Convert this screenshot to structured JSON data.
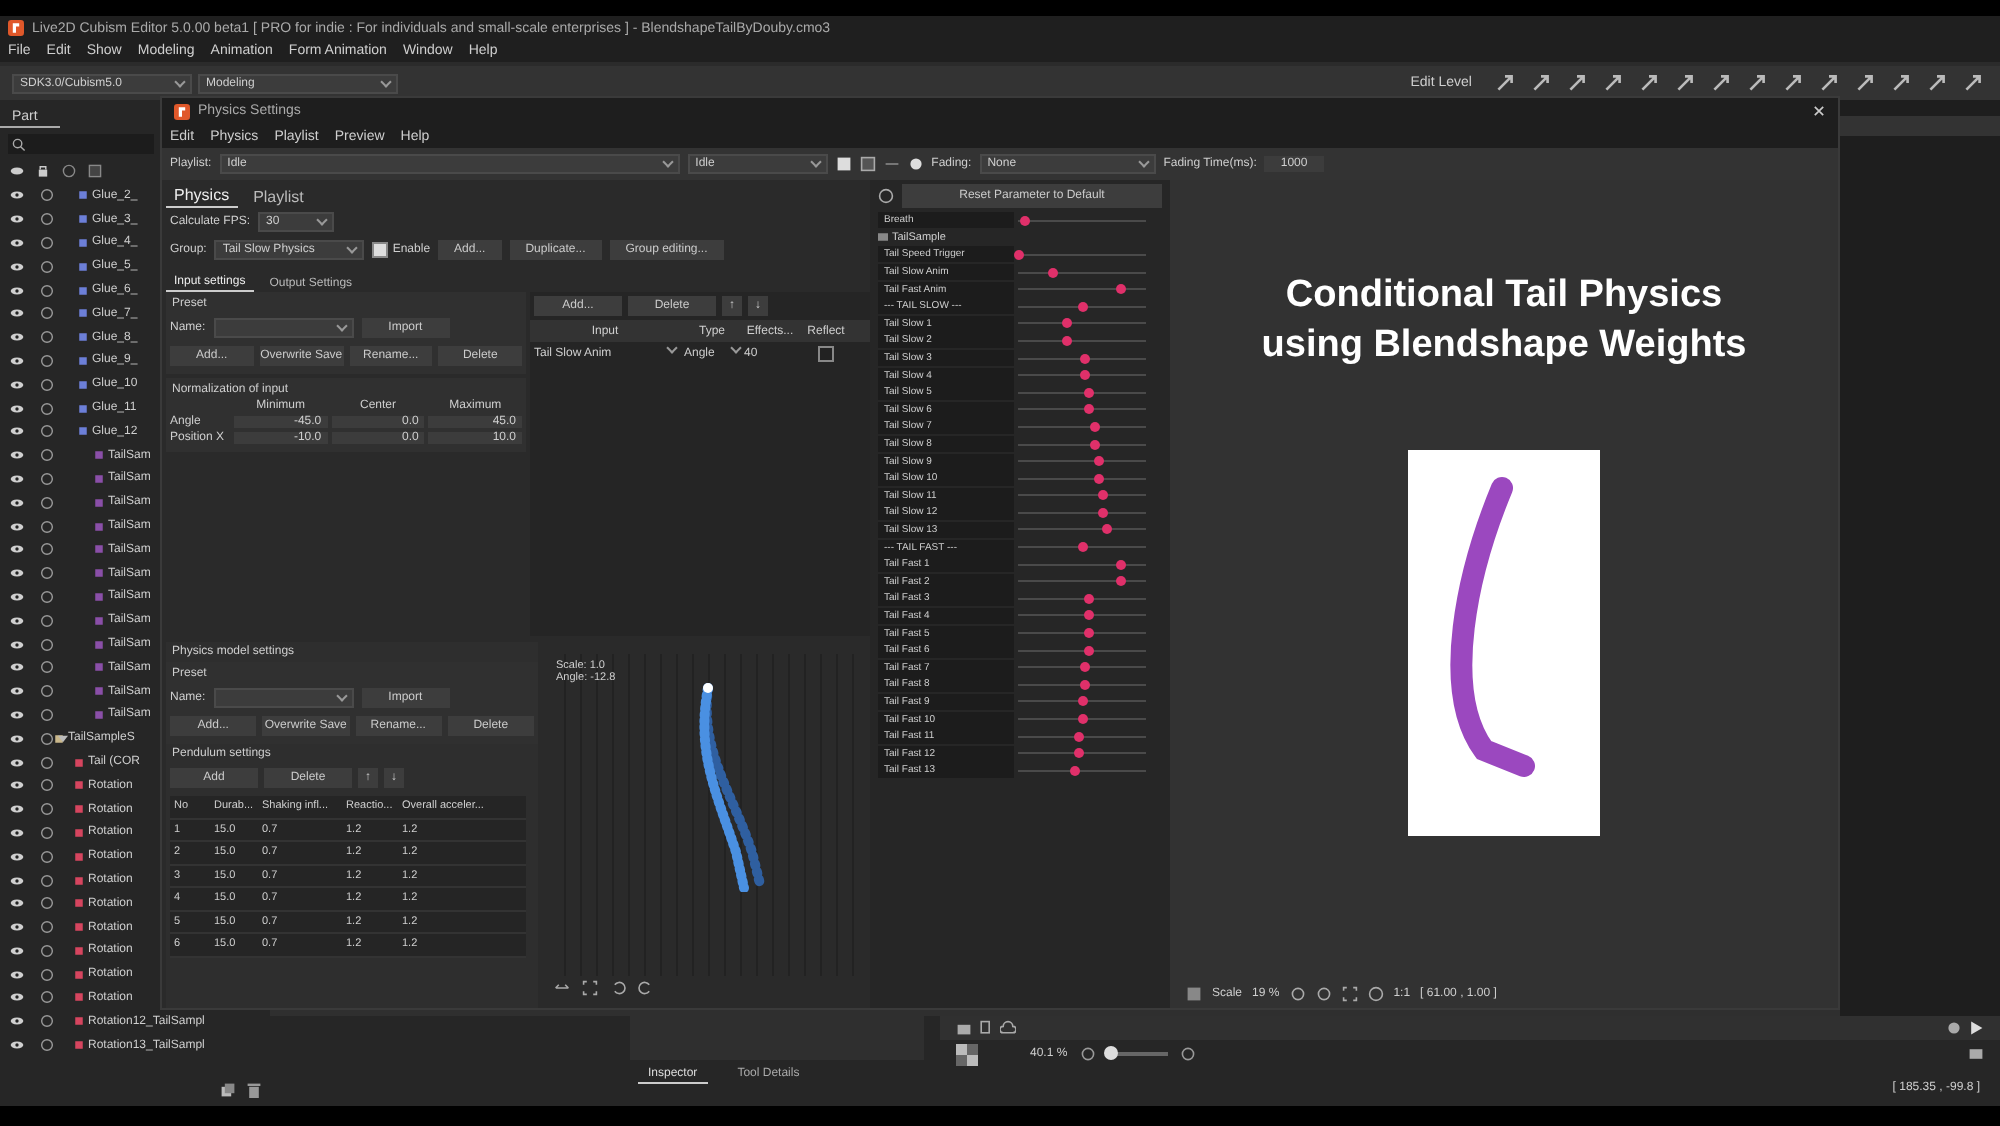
{
  "app": {
    "title": "Live2D Cubism Editor 5.0.00 beta1  [ PRO for indie : For individuals and small-scale enterprises ]  -  BlendshapeTailByDouby.cmo3",
    "menu": [
      "File",
      "Edit",
      "Show",
      "Modeling",
      "Animation",
      "Form Animation",
      "Window",
      "Help"
    ],
    "toolbar": {
      "version": "SDK3.0/Cubism5.0",
      "mode": "Modeling",
      "edit_level": "Edit Level"
    }
  },
  "parts_panel": {
    "tab": "Part",
    "tree": [
      {
        "label": "Glue_2_",
        "kind": "glue"
      },
      {
        "label": "Glue_3_",
        "kind": "glue"
      },
      {
        "label": "Glue_4_",
        "kind": "glue"
      },
      {
        "label": "Glue_5_",
        "kind": "glue"
      },
      {
        "label": "Glue_6_",
        "kind": "glue"
      },
      {
        "label": "Glue_7_",
        "kind": "glue"
      },
      {
        "label": "Glue_8_",
        "kind": "glue"
      },
      {
        "label": "Glue_9_",
        "kind": "glue"
      },
      {
        "label": "Glue_10",
        "kind": "glue"
      },
      {
        "label": "Glue_11",
        "kind": "glue"
      },
      {
        "label": "Glue_12",
        "kind": "glue"
      },
      {
        "label": "TailSam",
        "kind": "art"
      },
      {
        "label": "TailSam",
        "kind": "art"
      },
      {
        "label": "TailSam",
        "kind": "art"
      },
      {
        "label": "TailSam",
        "kind": "art"
      },
      {
        "label": "TailSam",
        "kind": "art"
      },
      {
        "label": "TailSam",
        "kind": "art"
      },
      {
        "label": "TailSam",
        "kind": "art"
      },
      {
        "label": "TailSam",
        "kind": "art"
      },
      {
        "label": "TailSam",
        "kind": "art"
      },
      {
        "label": "TailSam",
        "kind": "art"
      },
      {
        "label": "TailSam",
        "kind": "art"
      },
      {
        "label": "TailSam",
        "kind": "art"
      },
      {
        "label": "TailSampleS",
        "kind": "folder",
        "expanded": true,
        "children": [
          {
            "label": "Tail (COR",
            "kind": "rotation"
          },
          {
            "label": "Rotation",
            "kind": "rotation"
          },
          {
            "label": "Rotation",
            "kind": "rotation"
          },
          {
            "label": "Rotation",
            "kind": "rotation"
          },
          {
            "label": "Rotation",
            "kind": "rotation"
          },
          {
            "label": "Rotation",
            "kind": "rotation"
          },
          {
            "label": "Rotation",
            "kind": "rotation"
          },
          {
            "label": "Rotation",
            "kind": "rotation"
          },
          {
            "label": "Rotation",
            "kind": "rotation"
          },
          {
            "label": "Rotation",
            "kind": "rotation"
          },
          {
            "label": "Rotation",
            "kind": "rotation"
          },
          {
            "label": "Rotation12_TailSampl",
            "kind": "rotation"
          },
          {
            "label": "Rotation13_TailSampl",
            "kind": "rotation"
          }
        ]
      }
    ]
  },
  "dialog": {
    "title": "Physics Settings",
    "menu": [
      "Edit",
      "Physics",
      "Playlist",
      "Preview",
      "Help"
    ],
    "toolbar": {
      "playlist_label": "Playlist:",
      "playlist": "Idle",
      "motion": "Idle",
      "fading_label": "Fading:",
      "fading": "None",
      "fading_time_label": "Fading Time(ms):",
      "fading_time": "1000"
    },
    "tabs": [
      {
        "label": "Physics",
        "selected": true
      },
      {
        "label": "Playlist",
        "selected": false
      }
    ],
    "fps_label": "Calculate FPS:",
    "fps": "30",
    "group_label": "Group:",
    "group": "Tail Slow Physics",
    "enable": {
      "label": "Enable",
      "checked": true
    },
    "group_buttons": [
      "Add...",
      "Duplicate...",
      "Group editing..."
    ],
    "sub_tabs": [
      {
        "label": "Input settings",
        "selected": true
      },
      {
        "label": "Output Settings",
        "selected": false
      }
    ],
    "input_preset": {
      "title": "Preset",
      "name_label": "Name:",
      "import": "Import",
      "buttons": [
        "Add...",
        "Overwrite Save",
        "Rename...",
        "Delete"
      ]
    },
    "normalization": {
      "title": "Normalization of input",
      "columns": [
        "Minimum",
        "Center",
        "Maximum"
      ],
      "rows": [
        {
          "label": "Angle",
          "values": [
            "-45.0",
            "0.0",
            "45.0"
          ]
        },
        {
          "label": "Position X",
          "values": [
            "-10.0",
            "0.0",
            "10.0"
          ]
        }
      ]
    },
    "input_table": {
      "buttons": [
        "Add...",
        "Delete",
        "↑",
        "↓"
      ],
      "columns": [
        "Input",
        "Type",
        "Effects...",
        "Reflect"
      ],
      "rows": [
        {
          "input": "Tail Slow Anim",
          "type": "Angle",
          "effect": "40",
          "reflect": false
        }
      ]
    },
    "model_settings": {
      "title": "Physics model settings",
      "preset_title": "Preset",
      "name_label": "Name:",
      "import": "Import",
      "buttons": [
        "Add...",
        "Overwrite Save",
        "Rename...",
        "Delete"
      ],
      "pendulum_title": "Pendulum settings",
      "pendulum_buttons": [
        "Add",
        "Delete",
        "↑",
        "↓"
      ],
      "columns": [
        "No",
        "Durab...",
        "Shaking infl...",
        "Reactio...",
        "Overall acceler..."
      ],
      "rows": [
        [
          "1",
          "15.0",
          "0.7",
          "1.2",
          "1.2"
        ],
        [
          "2",
          "15.0",
          "0.7",
          "1.2",
          "1.2"
        ],
        [
          "3",
          "15.0",
          "0.7",
          "1.2",
          "1.2"
        ],
        [
          "4",
          "15.0",
          "0.7",
          "1.2",
          "1.2"
        ],
        [
          "5",
          "15.0",
          "0.7",
          "1.2",
          "1.2"
        ],
        [
          "6",
          "15.0",
          "0.7",
          "1.2",
          "1.2"
        ]
      ]
    },
    "preview": {
      "scale": "Scale: 1.0",
      "angle": "Angle: -12.8"
    },
    "reset_button": "Reset Parameter to Default",
    "parameters": [
      {
        "kind": "param",
        "name": "Breath",
        "level": 0.05
      },
      {
        "kind": "group",
        "name": "TailSample"
      },
      {
        "kind": "param",
        "name": "Tail Speed Trigger",
        "level": 0.0
      },
      {
        "kind": "param",
        "name": "Tail Slow Anim",
        "level": 0.28
      },
      {
        "kind": "param",
        "name": "Tail Fast Anim",
        "level": 0.8
      },
      {
        "kind": "param",
        "name": "--- TAIL SLOW ---",
        "level": 0.5
      },
      {
        "kind": "param",
        "name": "Tail Slow 1",
        "level": 0.38
      },
      {
        "kind": "param",
        "name": "Tail Slow 2",
        "level": 0.38
      },
      {
        "kind": "param",
        "name": "Tail Slow 3",
        "level": 0.53
      },
      {
        "kind": "param",
        "name": "Tail Slow 4",
        "level": 0.53
      },
      {
        "kind": "param",
        "name": "Tail Slow 5",
        "level": 0.56
      },
      {
        "kind": "param",
        "name": "Tail Slow 6",
        "level": 0.56
      },
      {
        "kind": "param",
        "name": "Tail Slow 7",
        "level": 0.6
      },
      {
        "kind": "param",
        "name": "Tail Slow 8",
        "level": 0.6
      },
      {
        "kind": "param",
        "name": "Tail Slow 9",
        "level": 0.63
      },
      {
        "kind": "param",
        "name": "Tail Slow 10",
        "level": 0.63
      },
      {
        "kind": "param",
        "name": "Tail Slow 11",
        "level": 0.66
      },
      {
        "kind": "param",
        "name": "Tail Slow 12",
        "level": 0.66
      },
      {
        "kind": "param",
        "name": "Tail Slow 13",
        "level": 0.69
      },
      {
        "kind": "param",
        "name": "--- TAIL FAST ---",
        "level": 0.5
      },
      {
        "kind": "param",
        "name": "Tail Fast 1",
        "level": 0.8
      },
      {
        "kind": "param",
        "name": "Tail Fast 2",
        "level": 0.8
      },
      {
        "kind": "param",
        "name": "Tail Fast 3",
        "level": 0.56
      },
      {
        "kind": "param",
        "name": "Tail Fast 4",
        "level": 0.56
      },
      {
        "kind": "param",
        "name": "Tail Fast 5",
        "level": 0.56
      },
      {
        "kind": "param",
        "name": "Tail Fast 6",
        "level": 0.56
      },
      {
        "kind": "param",
        "name": "Tail Fast 7",
        "level": 0.53
      },
      {
        "kind": "param",
        "name": "Tail Fast 8",
        "level": 0.52
      },
      {
        "kind": "param",
        "name": "Tail Fast 9",
        "level": 0.51
      },
      {
        "kind": "param",
        "name": "Tail Fast 10",
        "level": 0.5
      },
      {
        "kind": "param",
        "name": "Tail Fast 11",
        "level": 0.47
      },
      {
        "kind": "param",
        "name": "Tail Fast 12",
        "level": 0.47
      },
      {
        "kind": "param",
        "name": "Tail Fast 13",
        "level": 0.45
      }
    ],
    "canvas": {
      "caption": "Conditional Tail Physics\nusing Blendshape Weights",
      "scale_label": "Scale",
      "scale": "19 %",
      "ratio": "1:1",
      "coords": "[ 61.00 , 1.00 ]"
    }
  },
  "bottom": {
    "tabs": [
      {
        "label": "Inspector",
        "selected": true
      },
      {
        "label": "Tool Details",
        "selected": false
      }
    ],
    "zoom": "40.1 %",
    "zoom_slider": {
      "level": 0.05
    },
    "status": "[ 185.35 , -99.8 ]"
  }
}
